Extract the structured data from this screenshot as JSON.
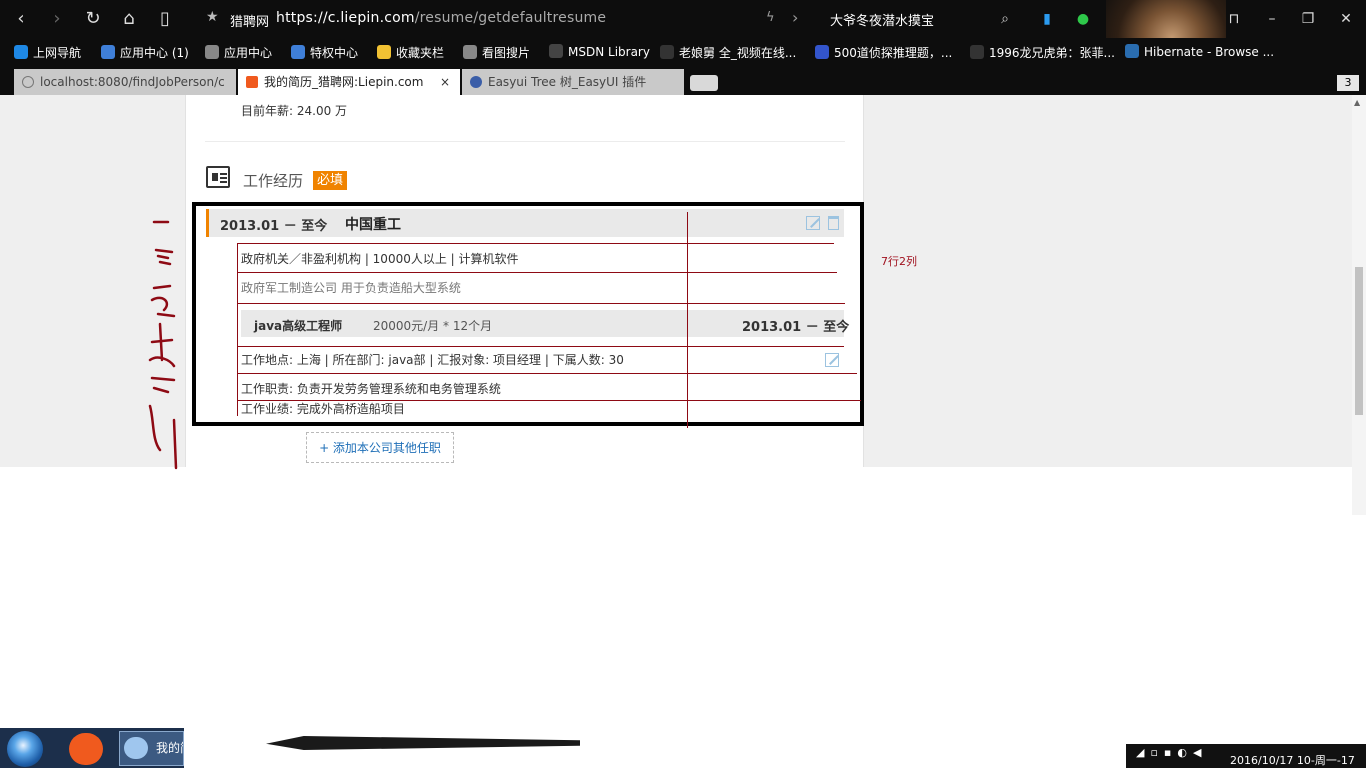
{
  "browser": {
    "site_name": "猎聘网",
    "url_host": "https://c.liepin.com",
    "url_path": "/resume/getdefaultresume",
    "headline": "大爷冬夜潜水摸宝",
    "tab_count": "3"
  },
  "bookmarks": [
    {
      "label": "上网导航",
      "icon": "ie-icon",
      "color": "#1e88e5"
    },
    {
      "label": "应用中心 (1)",
      "icon": "cloud-icon",
      "color": "#3f7fd8"
    },
    {
      "label": "应用中心",
      "icon": "globe-icon",
      "color": "#888888"
    },
    {
      "label": "特权中心",
      "icon": "cloud-icon",
      "color": "#3f7fd8"
    },
    {
      "label": "收藏夹栏",
      "icon": "folder-icon",
      "color": "#f2c233"
    },
    {
      "label": "看图搜片",
      "icon": "globe-icon",
      "color": "#888888"
    },
    {
      "label": "MSDN Library",
      "icon": "msdn-icon",
      "color": "#444444"
    },
    {
      "label": "老娘舅 全_视频在线...",
      "icon": "56-icon",
      "color": "#333333"
    },
    {
      "label": "500道侦探推理题，...",
      "icon": "paw-icon",
      "color": "#3355cc"
    },
    {
      "label": "1996龙兄虎弟：张菲...",
      "icon": "56-icon",
      "color": "#333333"
    },
    {
      "label": "Hibernate - Browse ...",
      "icon": "sf-icon",
      "color": "#2a6db0"
    }
  ],
  "tabs": [
    {
      "label": "localhost:8080/findJobPerson/c",
      "active": false
    },
    {
      "label": "我的简历_猎聘网:Liepin.com",
      "active": true,
      "close": "×"
    },
    {
      "label": "Easyui Tree 树_EasyUI 插件",
      "active": false
    }
  ],
  "resume": {
    "salary_line": "目前年薪:  24.00 万",
    "section_title": "工作经历",
    "required_badge": "必填",
    "company_date": "2013.01 －  至今",
    "company_name": "中国重工",
    "industry": "政府机关／非盈利机构 | 10000人以上 | 计算机软件",
    "company_desc": "政府军工制造公司 用于负责造船大型系统",
    "job_title": "java高级工程师",
    "job_pay": "20000元/月 * 12个月",
    "job_date": "2013.01 －  至今",
    "job_location": "工作地点: 上海 | 所在部门: java部 | 汇报对象: 项目经理 | 下属人数: 30",
    "job_duty": "工作职责: 负责开发劳务管理系统和电务管理系统",
    "job_result": "工作业绩: 完成外高桥造船项目",
    "add_job": "+ 添加本公司其他任职"
  },
  "annotation": "7行2列",
  "taskbar": {
    "app2_label": "我的简",
    "clock": "2016/10/17 10-周一-17"
  },
  "colors": {
    "accent_orange": "#f08300",
    "grid_red": "#8e0a14",
    "link_blue": "#1f6fb7"
  }
}
